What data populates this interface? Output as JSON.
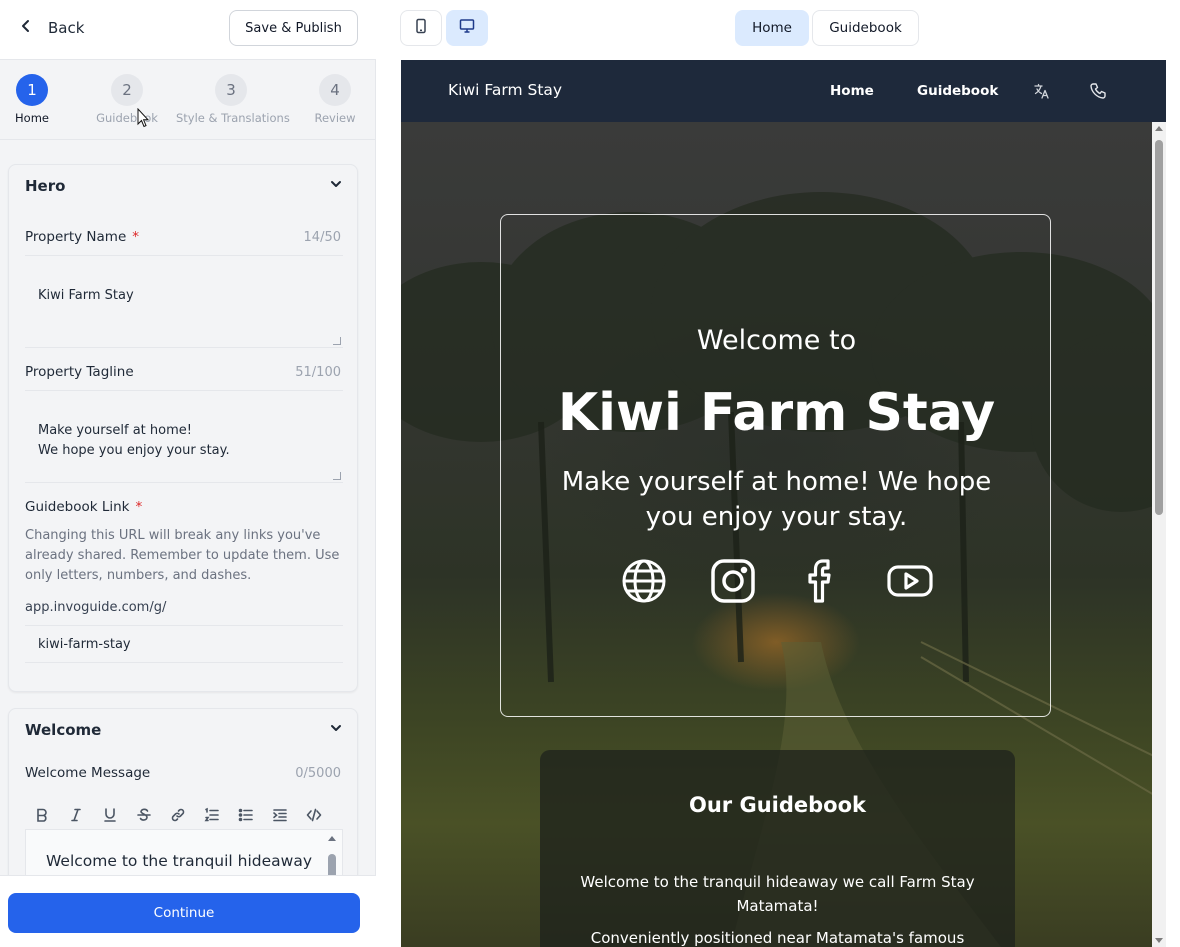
{
  "header": {
    "back_label": "Back",
    "publish_label": "Save & Publish"
  },
  "stepper": {
    "steps": [
      {
        "number": "1",
        "label": "Home",
        "active": true
      },
      {
        "number": "2",
        "label": "Guidebook",
        "active": false
      },
      {
        "number": "3",
        "label": "Style & Translations",
        "active": false
      },
      {
        "number": "4",
        "label": "Review",
        "active": false
      }
    ]
  },
  "hero_section": {
    "title": "Hero",
    "property_name": {
      "label": "Property Name",
      "required_mark": "*",
      "count": "14/50",
      "value": "Kiwi Farm Stay"
    },
    "property_tagline": {
      "label": "Property Tagline",
      "count": "51/100",
      "value": "Make yourself at home!\nWe hope you enjoy your stay."
    },
    "guidebook_link": {
      "label": "Guidebook Link",
      "required_mark": "*",
      "hint": "Changing this URL will break any links you've already shared. Remember to update them. Use only letters, numbers, and dashes.",
      "prefix": "app.invoguide.com/g/",
      "value": "kiwi-farm-stay"
    }
  },
  "welcome_section": {
    "title": "Welcome",
    "message_label": "Welcome Message",
    "count": "0/5000",
    "toolbar": [
      "bold-icon",
      "italic-icon",
      "underline-icon",
      "strikethrough-icon",
      "link-icon",
      "ordered-list-icon",
      "bullet-list-icon",
      "indent-icon",
      "code-icon"
    ],
    "editor_text": "Welcome to the tranquil hideaway"
  },
  "footer": {
    "continue_label": "Continue"
  },
  "preview_toolbar": {
    "device_icons": [
      "mobile-icon",
      "desktop-icon"
    ],
    "active_device": "desktop",
    "tabs": [
      "Home",
      "Guidebook"
    ],
    "active_tab": "Home"
  },
  "site": {
    "brand": "Kiwi Farm Stay",
    "nav_links": [
      "Home",
      "Guidebook"
    ],
    "nav_icons": [
      "translate-icon",
      "phone-icon"
    ],
    "hero": {
      "welcome": "Welcome to",
      "title": "Kiwi Farm Stay",
      "tagline": "Make yourself at home! We hope you enjoy your stay.",
      "social_icons": [
        "globe-icon",
        "instagram-icon",
        "facebook-icon",
        "youtube-icon"
      ]
    },
    "guidebook": {
      "title": "Our Guidebook",
      "paragraph1": "Welcome to the tranquil hideaway we call Farm Stay Matamata!",
      "paragraph2": "Conveniently positioned near Matamata's famous"
    }
  },
  "colors": {
    "accent": "#2563eb",
    "active_tab_bg": "#dbeafe",
    "site_nav_bg": "#1e293b",
    "required": "#dc2626"
  }
}
